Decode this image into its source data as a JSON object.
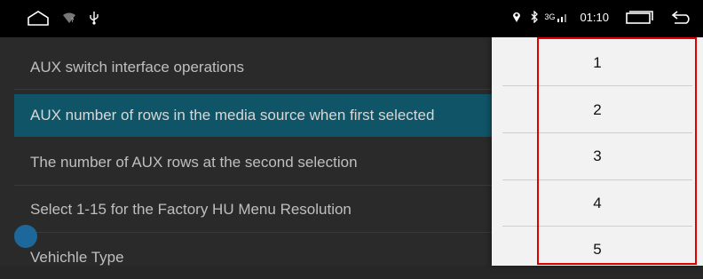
{
  "status_bar": {
    "time": "01:10",
    "network": "3G",
    "icons": [
      "home-icon",
      "wifi-icon",
      "usb-icon",
      "location-icon",
      "bluetooth-icon",
      "signal-icon",
      "recents-icon",
      "back-icon"
    ]
  },
  "settings": {
    "items": [
      {
        "label": "AUX switch interface operations"
      },
      {
        "label": "AUX number of rows in the media source when first selected"
      },
      {
        "label": "The number of AUX rows at the second selection"
      },
      {
        "label": "Select 1-15 for the Factory HU Menu Resolution"
      },
      {
        "label": "Vehichle Type"
      }
    ],
    "selected_index": 1
  },
  "picker": {
    "options": [
      "1",
      "2",
      "3",
      "4",
      "5"
    ]
  },
  "colors": {
    "selected_row": "#0f5567",
    "highlight": "#e00000"
  }
}
